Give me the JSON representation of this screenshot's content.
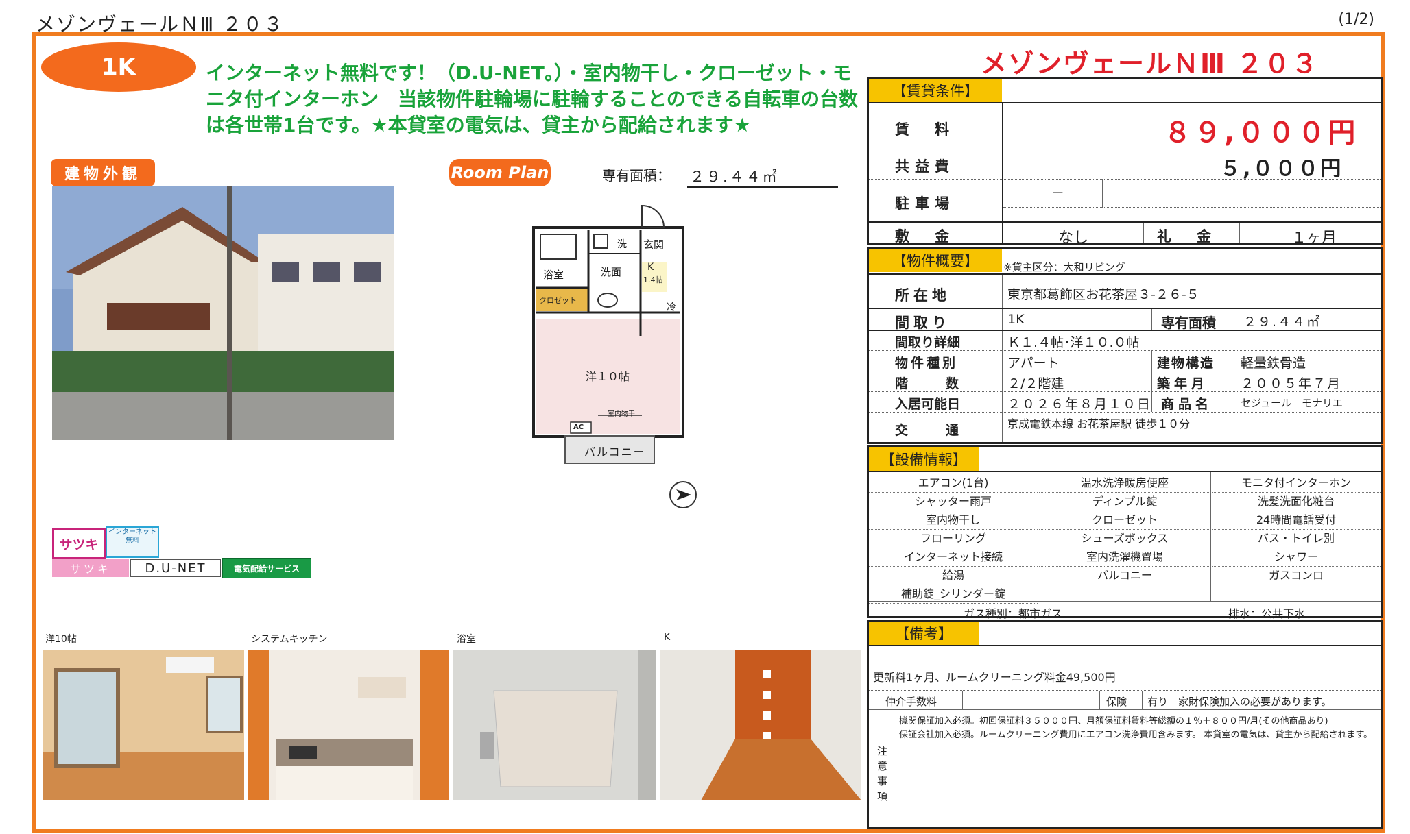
{
  "doc": {
    "title": "メゾンヴェールＮⅢ ２０３",
    "page": "(1/2)"
  },
  "left": {
    "layout_badge": "1K",
    "headline": "インターネット無料です！（D.U-NET。）・室内物干し・クローゼット・モニタ付インターホン　当該物件駐輪場に駐輪することのできる自転車の台数は各世帯1台です。★本貸室の電気は、貸主から配給されます★",
    "exterior_tag": "建物外観",
    "plan_tag": "Room Plan",
    "area_label": "専有面積：",
    "area_value": "２９.４４㎡",
    "plan_labels": {
      "bath": "浴室",
      "wash": "洗面",
      "washer": "洗",
      "entrance": "玄関",
      "kitchen": "K",
      "kitchen_size": "1.4帖",
      "closet": "クロゼット",
      "fridge": "冷",
      "room": "洋１０帖",
      "drying": "室内物干",
      "ac": "AC",
      "balcony": "バルコニー"
    },
    "badges": {
      "satsuki": "サツキ",
      "internet": "インターネット無料",
      "satsuki_bar": "サツキ",
      "dunet": "D.U-NET",
      "electric": "電気配給サービス"
    },
    "photos": [
      "洋10帖",
      "システムキッチン",
      "浴室",
      "K"
    ]
  },
  "right": {
    "title": "メゾンヴェールＮⅢ ２０３",
    "rent_header": "【賃貸条件】",
    "rent_label": "賃　料",
    "rent_value": "８９,０００円",
    "common_label": "共益費",
    "common_value": "５,０００円",
    "parking_label": "駐車場",
    "parking_value": "－",
    "deposit_label": "敷　金",
    "deposit_value": "なし",
    "key_label": "礼　金",
    "key_value": "１ヶ月",
    "outline_header": "【物件概要】",
    "owner_note": "※貸主区分：大和リビング",
    "address_label": "所在地",
    "address_value": "東京都葛飾区お花茶屋３-２６-５",
    "layout_label": "間取り",
    "layout_value": "1K",
    "area_label": "専有面積",
    "area_value": "２９.４４㎡",
    "layout_detail_label": "間取り詳細",
    "layout_detail_value": "Ｋ１.４帖･洋１０.０帖",
    "type_label": "物件種別",
    "type_value": "アパート",
    "structure_label": "建物構造",
    "structure_value": "軽量鉄骨造",
    "floor_label": "階　数",
    "floor_value": "２/２階建",
    "built_label": "築年月",
    "built_value": "２００５年７月",
    "movein_label": "入居可能日",
    "movein_value": "２０２６年８月１０日",
    "product_label": "商品名",
    "product_value": "セジュール　モナリエ",
    "access_label": "交　通",
    "access_value": "京成電鉄本線 お花茶屋駅 徒歩１０分",
    "equip_header": "【設備情報】",
    "equipment": [
      [
        "エアコン(1台)",
        "温水洗浄暖房便座",
        "モニタ付インターホン"
      ],
      [
        "シャッター雨戸",
        "ディンプル錠",
        "洗髪洗面化粧台"
      ],
      [
        "室内物干し",
        "クローゼット",
        "24時間電話受付"
      ],
      [
        "フローリング",
        "シューズボックス",
        "バス・トイレ別"
      ],
      [
        "インターネット接続",
        "室内洗濯機置場",
        "シャワー"
      ],
      [
        "給湯",
        "バルコニー",
        "ガスコンロ"
      ],
      [
        "補助錠_シリンダー錠",
        "",
        ""
      ]
    ],
    "gas": "ガス種別：都市ガス",
    "drain": "排水：公共下水",
    "notes_header": "【備考】",
    "notes_text": "更新料1ヶ月、ルームクリーニング料金49,500円",
    "broker_label": "仲介手数料",
    "insurance_label": "保険",
    "insurance_value": "有り　家財保険加入の必要があります。",
    "caution_label": "注意事項",
    "caution_1": "機関保証加入必須。初回保証料３５０００円、月額保証料賃料等総額の１％＋８００円/月(その他商品あり)",
    "caution_2": "保証会社加入必須。ルームクリーニング費用にエアコン洗浄費用含みます。 本貸室の電気は、貸主から配給されます。"
  },
  "colors": {
    "accent": "#f07c1f",
    "green": "#19a33a",
    "red": "#e0202a",
    "yellow": "#f7c300"
  }
}
